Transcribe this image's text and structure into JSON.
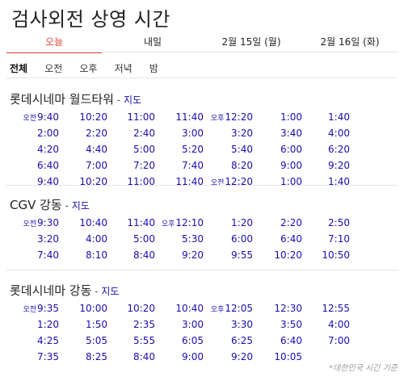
{
  "title": "검사외전 상영 시간",
  "date_tabs": [
    "오늘",
    "내일",
    "2월 15일 (월)",
    "2월 16일 (화)"
  ],
  "filter_tabs": [
    "전체",
    "오전",
    "오후",
    "저녁",
    "밤"
  ],
  "map_label": "지도",
  "theaters": [
    {
      "name": "롯데시네마 월드타워",
      "rows": [
        [
          {
            "p": "오전",
            "t": "9:40"
          },
          {
            "t": "10:20"
          },
          {
            "t": "11:00"
          },
          {
            "t": "11:40"
          },
          {
            "p": "오후",
            "t": "12:20"
          },
          {
            "t": "1:00"
          },
          {
            "t": "1:40"
          }
        ],
        [
          {
            "t": "2:00"
          },
          {
            "t": "2:20"
          },
          {
            "t": "2:40"
          },
          {
            "t": "3:00"
          },
          {
            "t": "3:20"
          },
          {
            "t": "3:40"
          },
          {
            "t": "4:00"
          }
        ],
        [
          {
            "t": "4:20"
          },
          {
            "t": "4:40"
          },
          {
            "t": "5:00"
          },
          {
            "t": "5:20"
          },
          {
            "t": "5:40"
          },
          {
            "t": "6:00"
          },
          {
            "t": "6:20"
          }
        ],
        [
          {
            "t": "6:40"
          },
          {
            "t": "7:00"
          },
          {
            "t": "7:20"
          },
          {
            "t": "7:40"
          },
          {
            "t": "8:20"
          },
          {
            "t": "9:00"
          },
          {
            "t": "9:20"
          }
        ],
        [
          {
            "t": "9:40"
          },
          {
            "t": "10:20"
          },
          {
            "t": "11:00"
          },
          {
            "t": "11:40"
          },
          {
            "p": "오전",
            "t": "12:20"
          },
          {
            "t": "1:00"
          },
          {
            "t": "1:40"
          }
        ]
      ]
    },
    {
      "name": "CGV 강동",
      "rows": [
        [
          {
            "p": "오전",
            "t": "9:30"
          },
          {
            "t": "10:40"
          },
          {
            "t": "11:40"
          },
          {
            "p": "오후",
            "t": "12:10"
          },
          {
            "t": "1:20"
          },
          {
            "t": "2:20"
          },
          {
            "t": "2:50"
          }
        ],
        [
          {
            "t": "3:20"
          },
          {
            "t": "4:00"
          },
          {
            "t": "5:00"
          },
          {
            "t": "5:30"
          },
          {
            "t": "6:00"
          },
          {
            "t": "6:40"
          },
          {
            "t": "7:10"
          }
        ],
        [
          {
            "t": "7:40"
          },
          {
            "t": "8:10"
          },
          {
            "t": "8:40"
          },
          {
            "t": "9:20"
          },
          {
            "t": "9:55"
          },
          {
            "t": "10:20"
          },
          {
            "t": "10:50"
          }
        ]
      ]
    },
    {
      "name": "롯데시네마 강동",
      "rows": [
        [
          {
            "p": "오전",
            "t": "9:35"
          },
          {
            "t": "10:00"
          },
          {
            "t": "10:20"
          },
          {
            "t": "10:40"
          },
          {
            "p": "오후",
            "t": "12:05"
          },
          {
            "t": "12:30"
          },
          {
            "t": "12:55"
          }
        ],
        [
          {
            "t": "1:20"
          },
          {
            "t": "1:50"
          },
          {
            "t": "2:35"
          },
          {
            "t": "3:00"
          },
          {
            "t": "3:30"
          },
          {
            "t": "3:50"
          },
          {
            "t": "4:00"
          }
        ],
        [
          {
            "t": "4:25"
          },
          {
            "t": "5:05"
          },
          {
            "t": "5:55"
          },
          {
            "t": "6:05"
          },
          {
            "t": "6:25"
          },
          {
            "t": "6:40"
          },
          {
            "t": "7:00"
          }
        ],
        [
          {
            "t": "7:35"
          },
          {
            "t": "8:25"
          },
          {
            "t": "8:40"
          },
          {
            "t": "9:00"
          },
          {
            "t": "9:20"
          },
          {
            "t": "10:05"
          }
        ]
      ]
    }
  ],
  "footnote": "*대한민국 시간 기준",
  "colors": {
    "accent": "#dd4b39",
    "link": "#1a0dab"
  }
}
